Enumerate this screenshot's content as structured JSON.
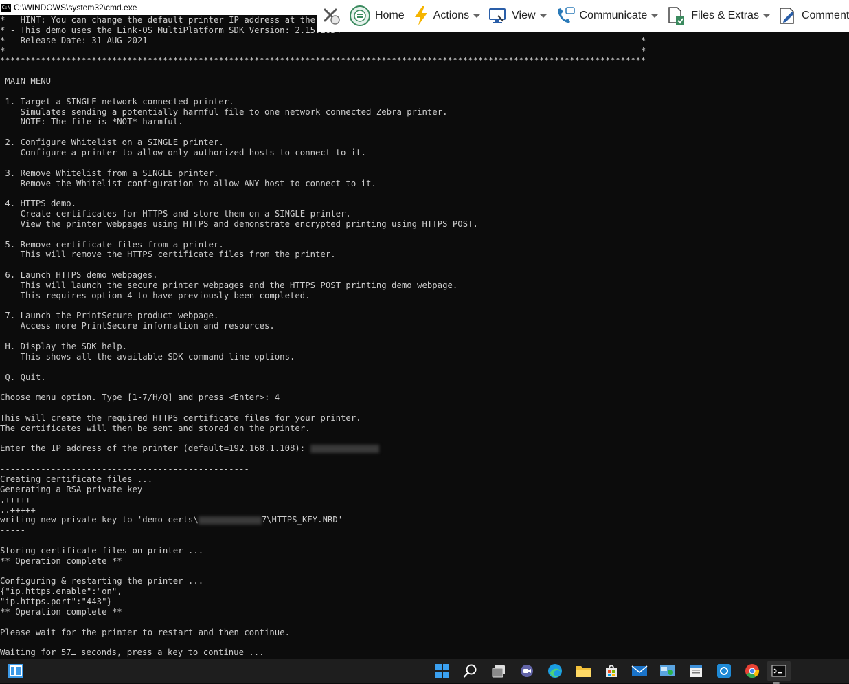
{
  "window": {
    "title": "C:\\WINDOWS\\system32\\cmd.exe"
  },
  "toolbar": {
    "items": [
      {
        "label": "",
        "icon": "disconnect-icon"
      },
      {
        "label": "Home",
        "icon": "home-icon"
      },
      {
        "label": "Actions",
        "icon": "lightning-icon",
        "dropdown": true
      },
      {
        "label": "View",
        "icon": "monitor-icon",
        "dropdown": true
      },
      {
        "label": "Communicate",
        "icon": "phone-icon",
        "dropdown": true
      },
      {
        "label": "Files & Extras",
        "icon": "files-icon",
        "dropdown": true
      },
      {
        "label": "Comment",
        "icon": "comment-icon"
      }
    ]
  },
  "console": {
    "lines": [
      "*   HINT: You can change the default printer IP address at the",
      "* - This demo uses the Link-OS MultiPlatform SDK Version: 2.15.2634",
      "* - Release Date: 31 AUG 2021                                                                                                 *",
      "*                                                                                                                             *",
      "*******************************************************************************************************************************",
      "",
      " MAIN MENU",
      "",
      " 1. Target a SINGLE network connected printer.",
      "    Simulates sending a potentially harmful file to one network connected Zebra printer.",
      "    NOTE: The file is *NOT* harmful.",
      "",
      " 2. Configure Whitelist on a SINGLE printer.",
      "    Configure a printer to allow only authorized hosts to connect to it.",
      "",
      " 3. Remove Whitelist from a SINGLE printer.",
      "    Remove the Whitelist configuration to allow ANY host to connect to it.",
      "",
      " 4. HTTPS demo.",
      "    Create certificates for HTTPS and store them on a SINGLE printer.",
      "    View the printer webpages using HTTPS and demonstrate encrypted printing using HTTPS POST.",
      "",
      " 5. Remove certificate files from a printer.",
      "    This will remove the HTTPS certificate files from the printer.",
      "",
      " 6. Launch HTTPS demo webpages.",
      "    This will launch the secure printer webpages and the HTTPS POST printing demo webpage.",
      "    This requires option 4 to have previously been completed.",
      "",
      " 7. Launch the PrintSecure product webpage.",
      "    Access more PrintSecure information and resources.",
      "",
      " H. Display the SDK help.",
      "    This shows all the available SDK command line options.",
      "",
      " Q. Quit.",
      "",
      "Choose menu option. Type [1-7/H/Q] and press <Enter>: 4",
      "",
      "This will create the required HTTPS certificate files for your printer.",
      "The certificates will then be sent and stored on the printer.",
      "",
      "Enter the IP address of the printer (default=192.168.1.108): ",
      "",
      "-------------------------------------------------",
      "Creating certificate files ...",
      "Generating a RSA private key",
      ".+++++",
      "..+++++",
      "writing new private key to 'demo-certs\\",
      "-----",
      "",
      "Storing certificate files on printer ...",
      "** Operation complete **",
      "",
      "Configuring & restarting the printer ...",
      "{\"ip.https.enable\":\"on\",",
      "\"ip.https.port\":\"443\"}",
      "** Operation complete **",
      "",
      "Please wait for the printer to restart and then continue.",
      "",
      "Waiting for 57"
    ],
    "key_path_suffix": "7\\HTTPS_KEY.NRD'",
    "wait_suffix": " seconds, press a key to continue ..."
  },
  "taskbar": {
    "icons": [
      "windows-start-icon",
      "search-icon",
      "task-view-icon",
      "teams-chat-icon",
      "edge-browser-icon",
      "file-explorer-icon",
      "store-icon",
      "mail-icon",
      "control-panel-icon",
      "notepad-icon",
      "remote-support-icon",
      "chrome-icon",
      "terminal-icon"
    ]
  }
}
